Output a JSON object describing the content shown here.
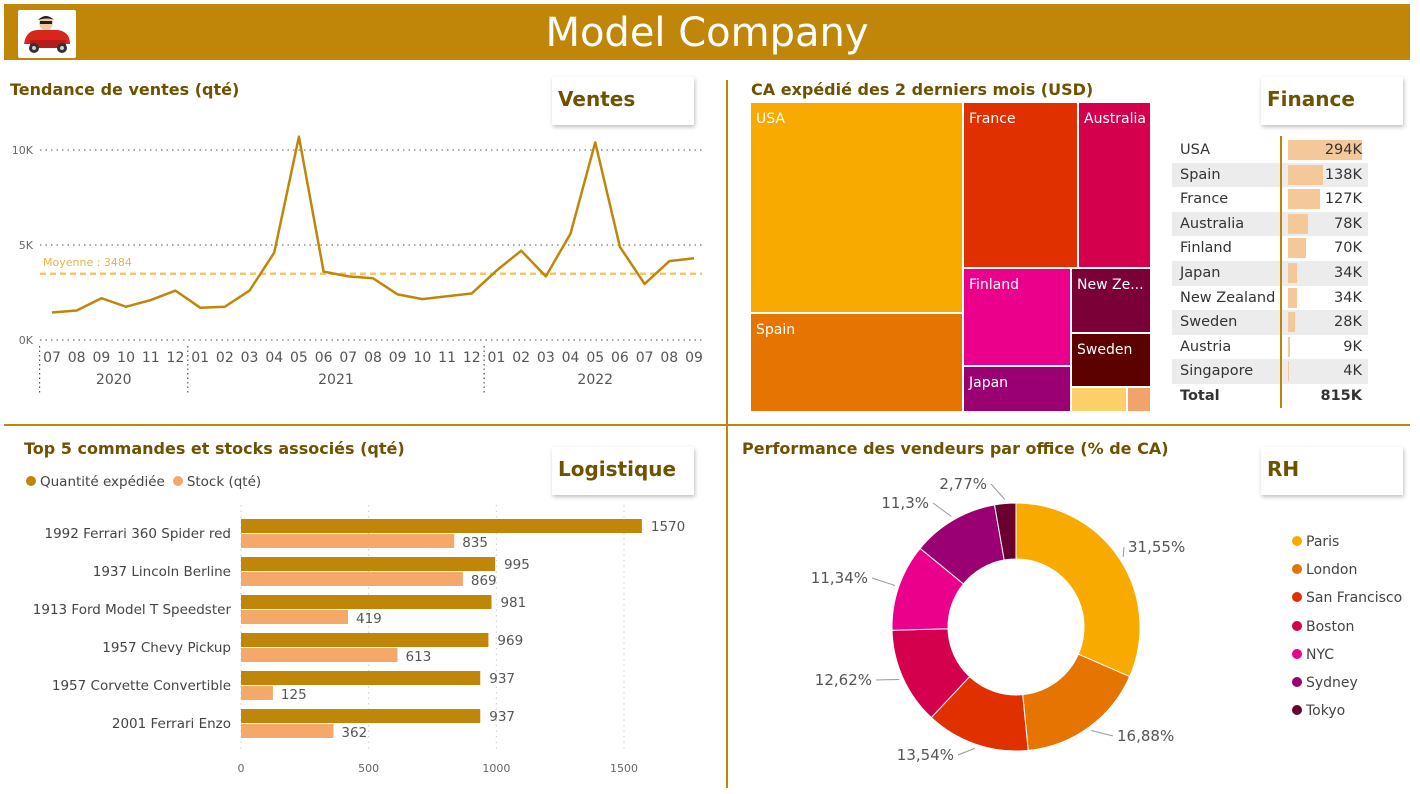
{
  "header": {
    "title": "Model Company"
  },
  "sections": {
    "sales": {
      "title": "Tendance de ventes (qté)",
      "tag": "Ventes"
    },
    "finance": {
      "title": "CA expédié des 2 derniers mois (USD)",
      "tag": "Finance"
    },
    "logistics": {
      "title": "Top 5 commandes et stocks associés (qté)",
      "tag": "Logistique"
    },
    "hr": {
      "title": "Performance des vendeurs par office (% de CA)",
      "tag": "RH"
    }
  },
  "colors": {
    "brand": "#c0860a",
    "line": "#bf860a",
    "avg": "#f6c469",
    "light_bar": "#f4a96b",
    "finance_bar": "#f5c89a"
  },
  "chart_data": [
    {
      "type": "line",
      "title": "Tendance de ventes (qté)",
      "x_months": [
        "07",
        "08",
        "09",
        "10",
        "11",
        "12",
        "01",
        "02",
        "03",
        "04",
        "05",
        "06",
        "07",
        "08",
        "09",
        "10",
        "11",
        "12",
        "01",
        "02",
        "03",
        "04",
        "05",
        "06",
        "07",
        "08",
        "09"
      ],
      "x_years": [
        "2020",
        "2021",
        "2022"
      ],
      "y_ticks": [
        "0K",
        "5K",
        "10K"
      ],
      "ylim": [
        0,
        10500
      ],
      "values": [
        1450,
        1550,
        2200,
        1750,
        2100,
        2600,
        1700,
        1750,
        2600,
        4600,
        10700,
        3600,
        3350,
        3250,
        2400,
        2150,
        2300,
        2450,
        3650,
        4700,
        3350,
        5600,
        10400,
        4900,
        2950,
        4150,
        4300
      ],
      "average": {
        "label": "Moyenne : 3484",
        "value": 3484
      },
      "grid": "dotted-horizontal"
    },
    {
      "type": "treemap",
      "title": "CA expédié des 2 derniers mois (USD)",
      "labels": [
        "USA",
        "France",
        "Australia",
        "Spain",
        "Finland",
        "New Ze...",
        "Sweden",
        "Japan"
      ],
      "colors": [
        "#f8aa00",
        "#e03000",
        "#d4004d",
        "#e57400",
        "#ea008b",
        "#7c0038",
        "#5c0000",
        "#9b0073",
        "#fdd06a",
        "#f2a36a"
      ]
    },
    {
      "type": "table",
      "title": "Finance",
      "rows": [
        {
          "country": "USA",
          "value": "294K",
          "num": 294
        },
        {
          "country": "Spain",
          "value": "138K",
          "num": 138
        },
        {
          "country": "France",
          "value": "127K",
          "num": 127
        },
        {
          "country": "Australia",
          "value": "78K",
          "num": 78
        },
        {
          "country": "Finland",
          "value": "70K",
          "num": 70
        },
        {
          "country": "Japan",
          "value": "34K",
          "num": 34
        },
        {
          "country": "New Zealand",
          "value": "34K",
          "num": 34
        },
        {
          "country": "Sweden",
          "value": "28K",
          "num": 28
        },
        {
          "country": "Austria",
          "value": "9K",
          "num": 9
        },
        {
          "country": "Singapore",
          "value": "4K",
          "num": 4
        }
      ],
      "total": {
        "label": "Total",
        "value": "815K"
      }
    },
    {
      "type": "bar",
      "title": "Top 5 commandes et stocks associés (qté)",
      "orientation": "horizontal",
      "categories": [
        "1992 Ferrari 360 Spider red",
        "1937 Lincoln Berline",
        "1913 Ford Model T Speedster",
        "1957 Chevy Pickup",
        "1957 Corvette Convertible",
        "2001 Ferrari Enzo"
      ],
      "series": [
        {
          "name": "Quantité expédiée",
          "color": "#bf860a",
          "values": [
            1570,
            995,
            981,
            969,
            937,
            937
          ]
        },
        {
          "name": "Stock (qté)",
          "color": "#f4a96b",
          "values": [
            835,
            869,
            419,
            613,
            125,
            362
          ]
        }
      ],
      "x_ticks": [
        "0",
        "500",
        "1000",
        "1500"
      ],
      "xlim": [
        0,
        1800
      ]
    },
    {
      "type": "pie",
      "subtype": "donut",
      "title": "Performance des vendeurs par office (% de CA)",
      "labels": [
        "Paris",
        "London",
        "San Francisco",
        "Boston",
        "NYC",
        "Sydney",
        "Tokyo"
      ],
      "values": [
        31.55,
        16.88,
        13.54,
        12.62,
        11.34,
        11.3,
        2.77
      ],
      "value_labels": [
        "31,55%",
        "16,88%",
        "13,54%",
        "12,62%",
        "11,34%",
        "11,3%",
        "2,77%"
      ],
      "colors": [
        "#f8aa00",
        "#e57400",
        "#e03000",
        "#d4004d",
        "#ea008b",
        "#9b0073",
        "#6a0030"
      ],
      "legend": "right"
    }
  ]
}
